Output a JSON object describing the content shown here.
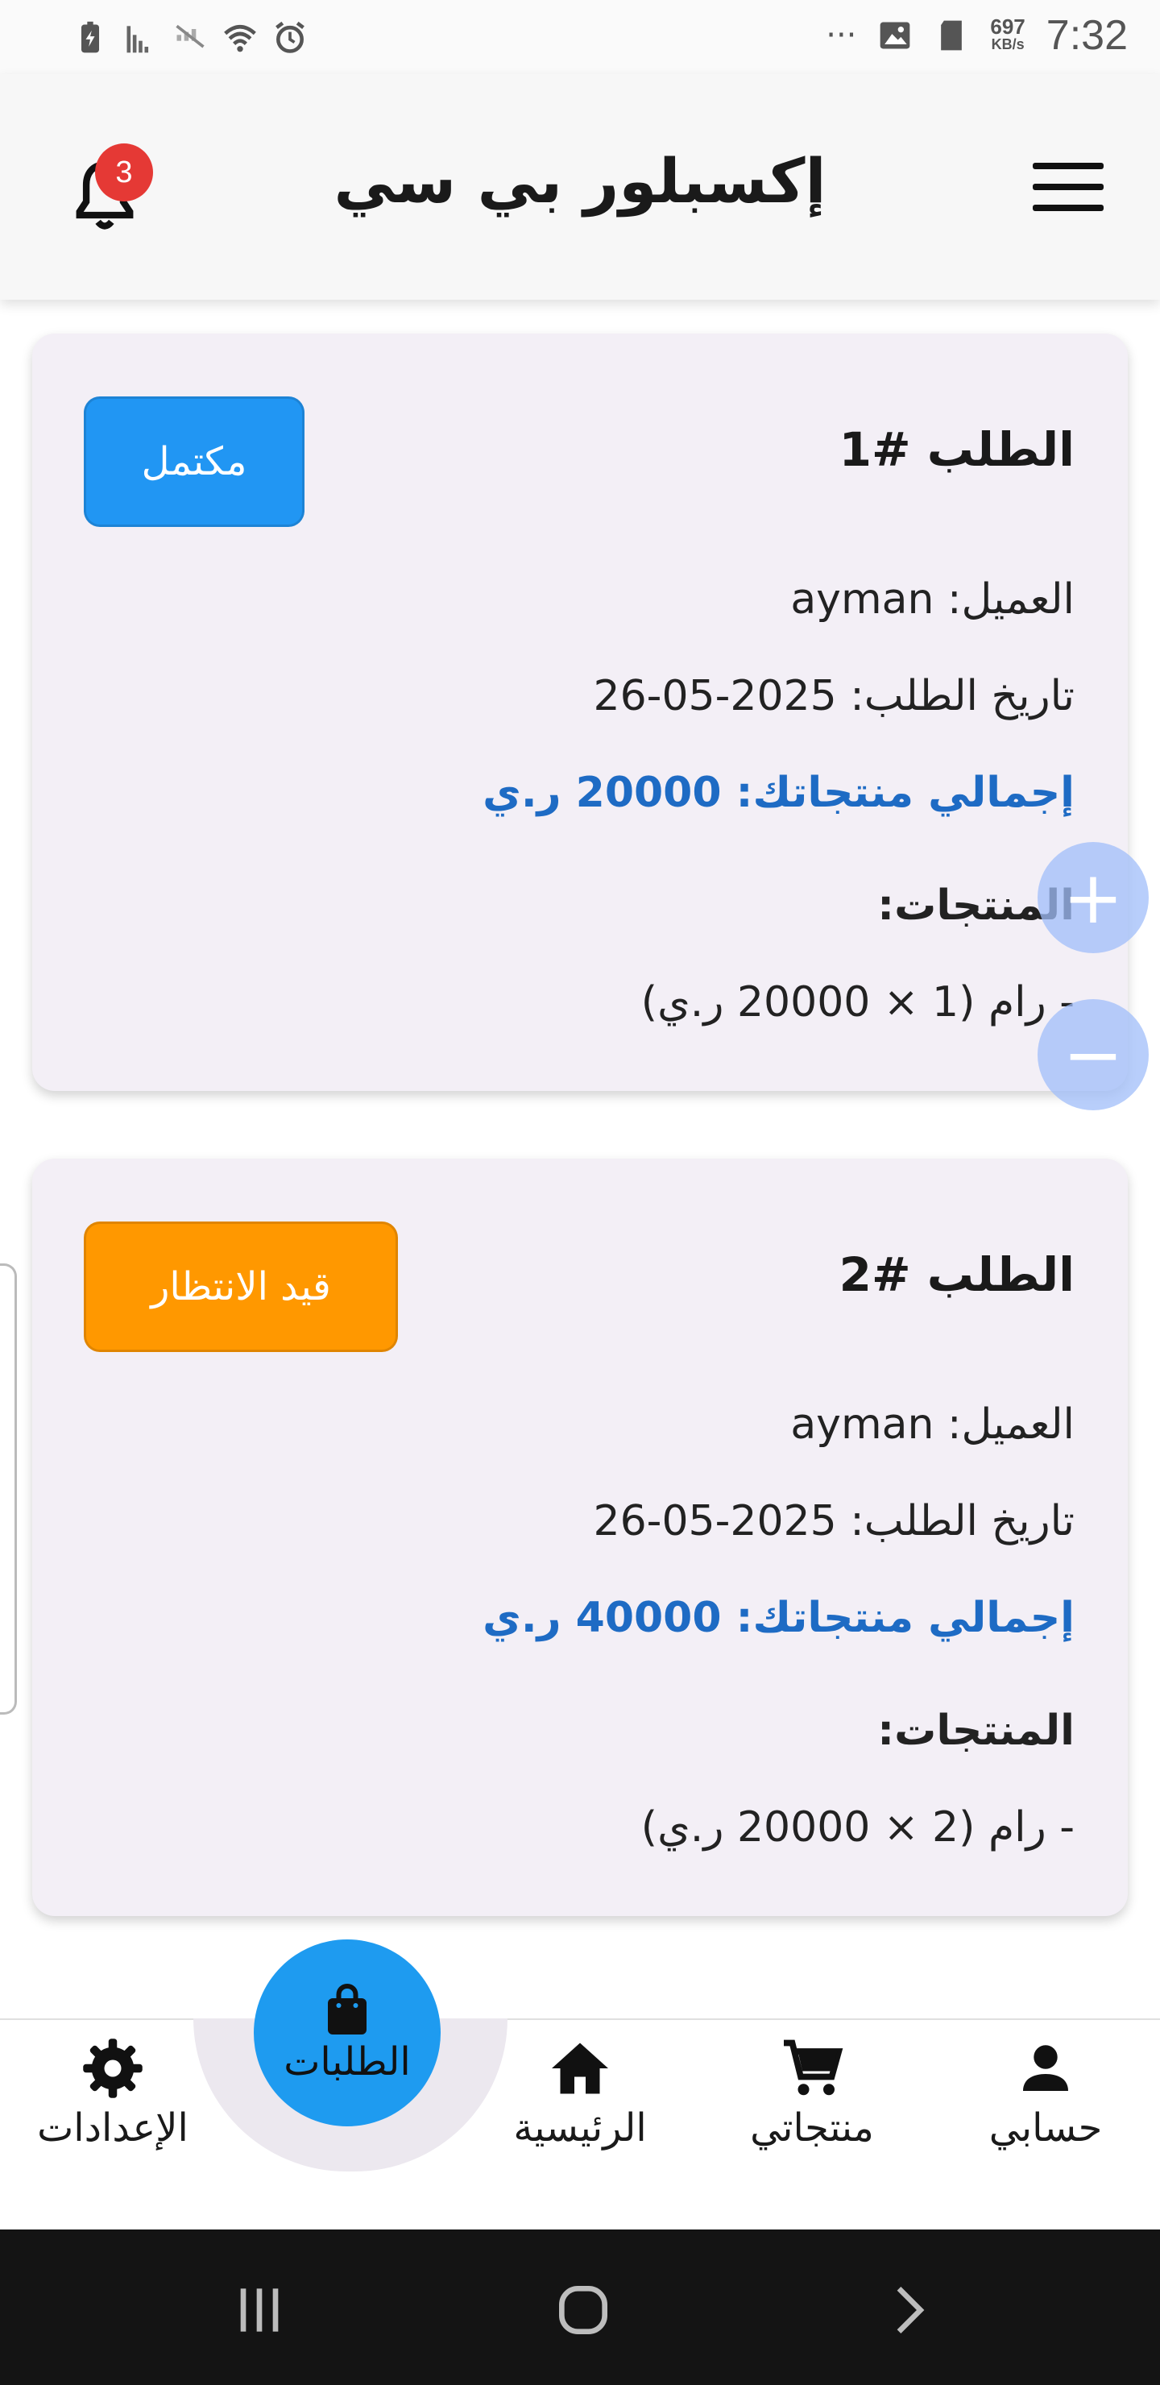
{
  "status_bar": {
    "time": "7:32",
    "speed_value": "697",
    "speed_unit": "KB/s",
    "overflow": "···"
  },
  "app_bar": {
    "title": "إكسبلور بي سي",
    "notification_count": "3"
  },
  "orders": [
    {
      "number": "الطلب #1",
      "status": "مكتمل",
      "status_color": "#2196f3",
      "customer": "العميل: ayman",
      "date": "تاريخ الطلب: 2025-05-26",
      "total_label": "إجمالي منتجاتك:",
      "total_value": "20000",
      "total_currency": "ر.ي",
      "products_label": "المنتجات:",
      "items": [
        "- رام (1 × 20000 ر.ي)"
      ]
    },
    {
      "number": "الطلب #2",
      "status": "قيد الانتظار",
      "status_color": "#ff9800",
      "customer": "العميل: ayman",
      "date": "تاريخ الطلب: 2025-05-26",
      "total_label": "إجمالي منتجاتك:",
      "total_value": "40000",
      "total_currency": "ر.ي",
      "products_label": "المنتجات:",
      "items": [
        "- رام (2 × 20000 ر.ي)"
      ]
    }
  ],
  "zoom": {
    "plus": "+",
    "minus": "−"
  },
  "bottom_nav": {
    "account": "حسابي",
    "products": "منتجاتي",
    "home": "الرئيسية",
    "orders": "الطلبات",
    "settings": "الإعدادات",
    "active": "orders"
  },
  "colors": {
    "accent": "#1e9bf0",
    "total_text": "#1e6bc4",
    "card_bg": "#f3eff6",
    "badge": "#e53935"
  }
}
